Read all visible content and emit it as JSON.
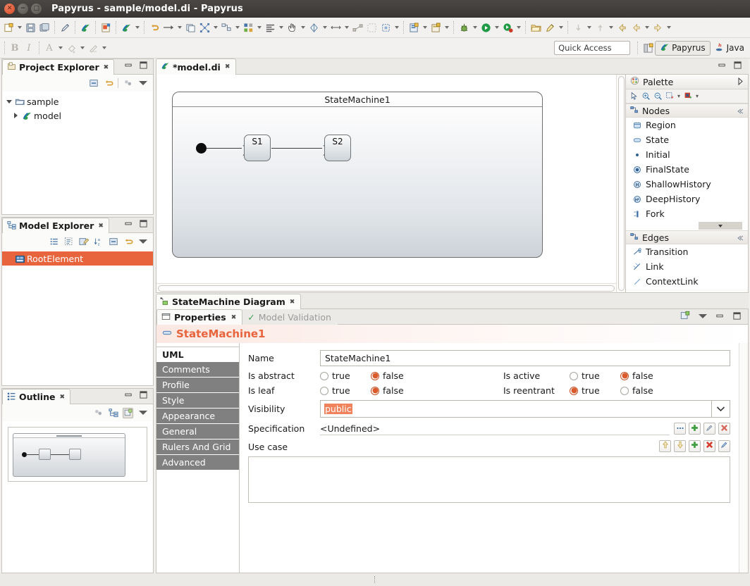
{
  "window": {
    "title": "Papyrus - sample/model.di - Papyrus",
    "controls": {
      "close": "close-button",
      "minimize": "minimize-button",
      "maximize": "maximize-button"
    }
  },
  "toolbar": {
    "quick_access_placeholder": "Quick Access",
    "perspectives": [
      {
        "label": "Papyrus",
        "active": true
      },
      {
        "label": "Java",
        "active": false
      }
    ],
    "format_buttons": {
      "bold": "B",
      "italic": "I"
    }
  },
  "project_explorer": {
    "tab_label": "Project Explorer",
    "tree": [
      {
        "label": "sample",
        "icon": "folder-icon",
        "expanded": true,
        "indent": 0
      },
      {
        "label": "model",
        "icon": "papyrus-model-icon",
        "expanded": false,
        "indent": 1
      }
    ]
  },
  "model_explorer": {
    "tab_label": "Model Explorer",
    "tree": [
      {
        "label": "RootElement",
        "icon": "model-icon",
        "selected": true
      }
    ],
    "selection_color": "#e8643c"
  },
  "outline": {
    "tab_label": "Outline"
  },
  "editor": {
    "tab_label": "*model.di",
    "diagram": {
      "frame_title": "StateMachine1",
      "states": [
        {
          "name": "S1"
        },
        {
          "name": "S2"
        }
      ],
      "initial_node": "initial-state-node"
    },
    "diagram_tab_label": "StateMachine Diagram"
  },
  "palette": {
    "title": "Palette",
    "tools": [
      "select-tool",
      "zoom-in-tool",
      "zoom-out-tool",
      "marquee-tool",
      "format-painter-tool"
    ],
    "sections": [
      {
        "name": "Nodes",
        "items": [
          {
            "label": "Region",
            "icon": "region-icon"
          },
          {
            "label": "State",
            "icon": "state-icon"
          },
          {
            "label": "Initial",
            "icon": "initial-icon"
          },
          {
            "label": "FinalState",
            "icon": "final-state-icon"
          },
          {
            "label": "ShallowHistory",
            "icon": "shallow-history-icon"
          },
          {
            "label": "DeepHistory",
            "icon": "deep-history-icon"
          },
          {
            "label": "Fork",
            "icon": "fork-icon"
          }
        ]
      },
      {
        "name": "Edges",
        "items": [
          {
            "label": "Transition",
            "icon": "transition-icon"
          },
          {
            "label": "Link",
            "icon": "link-icon"
          },
          {
            "label": "ContextLink",
            "icon": "context-link-icon"
          }
        ]
      }
    ]
  },
  "properties": {
    "tabs": [
      {
        "label": "Properties",
        "active": true
      },
      {
        "label": "Model Validation",
        "active": false,
        "icon": "checkmark-icon"
      }
    ],
    "element_title": "StateMachine1",
    "element_title_color": "#e8643c",
    "side_tabs": [
      {
        "label": "UML",
        "active": true
      },
      {
        "label": "Comments",
        "active": false
      },
      {
        "label": "Profile",
        "active": false
      },
      {
        "label": "Style",
        "active": false
      },
      {
        "label": "Appearance",
        "active": false
      },
      {
        "label": "General",
        "active": false
      },
      {
        "label": "Rulers And Grid",
        "active": false
      },
      {
        "label": "Advanced",
        "active": false
      }
    ],
    "fields": {
      "name_label": "Name",
      "name_value": "StateMachine1",
      "is_abstract_label": "Is abstract",
      "is_abstract_value": "false",
      "is_leaf_label": "Is leaf",
      "is_leaf_value": "false",
      "is_active_label": "Is active",
      "is_active_value": "false",
      "is_reentrant_label": "Is reentrant",
      "is_reentrant_value": "true",
      "true_label": "true",
      "false_label": "false",
      "visibility_label": "Visibility",
      "visibility_value": "public",
      "specification_label": "Specification",
      "specification_value": "<Undefined>",
      "use_case_label": "Use case",
      "use_case_items": []
    },
    "spec_buttons": [
      "browse-button",
      "add-button",
      "edit-button",
      "delete-button"
    ],
    "usecase_buttons": [
      "move-up-button",
      "move-down-button",
      "add-button",
      "delete-button",
      "edit-button"
    ]
  }
}
